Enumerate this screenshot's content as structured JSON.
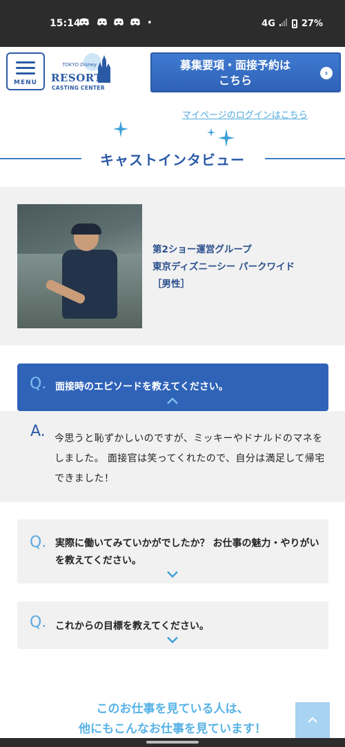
{
  "status_bar": {
    "time": "15:14",
    "notification_icons": [
      "discord-icon",
      "discord-icon",
      "discord-icon",
      "discord-icon"
    ],
    "dot": "•",
    "network": "4G",
    "battery": "27%"
  },
  "header": {
    "menu_label": "MENU",
    "logo_small": "TOKYO Disney",
    "logo_resort": "RESORT",
    "logo_casting": "CASTING CENTER",
    "recruit_button": "募集要項・面接予約は\nこちら",
    "recruit_arrow": "›"
  },
  "login_link": "マイページのログインはこちら",
  "section_title": "キャストインタビュー",
  "profile": {
    "line1": "第2ショー運営グループ",
    "line2": "東京ディズニーシー パークワイド",
    "line3": "［男性］"
  },
  "qa": [
    {
      "q_mark": "Q.",
      "question": "面接時のエピソードを教えてください。",
      "expanded": true,
      "a_mark": "A.",
      "answer": "今思うと恥ずかしいのですが、ミッキーやドナルドのマネをしました。 面接官は笑ってくれたので、自分は満足して帰宅できました！"
    },
    {
      "q_mark": "Q.",
      "question": "実際に働いてみていかがでしたか？ お仕事の魅力・やりがいを教えてください。",
      "expanded": false
    },
    {
      "q_mark": "Q.",
      "question": "これからの目標を教えてください。",
      "expanded": false
    }
  ],
  "bottom_heading": "このお仕事を見ている人は、\n他にもこんなお仕事を見ています！",
  "to_top": "^",
  "colors": {
    "brand_blue": "#2f63b8",
    "accent_light_blue": "#56b2e6",
    "panel_gray": "#f1f1f1"
  }
}
